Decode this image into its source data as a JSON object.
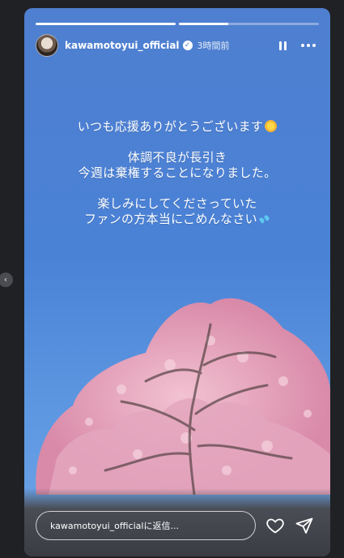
{
  "story": {
    "progress": [
      1.0,
      0.35
    ],
    "username": "kawamotoyui_official",
    "verified_mark": "✓",
    "time": "3時間前",
    "caption": {
      "line1": "いつも応援ありがとうございます",
      "line2": "体調不良が長引き",
      "line3": "今週は棄権することになりました。",
      "line4": "楽しみにしてくださっていた",
      "line5": "ファンの方本当にごめんなさい"
    },
    "reply_placeholder": "kawamotoyui_officialに返信..."
  },
  "icons": {
    "pause": "pause-icon",
    "more": "more-icon",
    "heart": "heart-icon",
    "send": "send-icon",
    "prev": "chevron-left-icon"
  },
  "prev_arrow": "‹",
  "colors": {
    "sky": "#4f7fd0",
    "blossom": "#e7a9c0",
    "footer": "#3a3c42"
  }
}
